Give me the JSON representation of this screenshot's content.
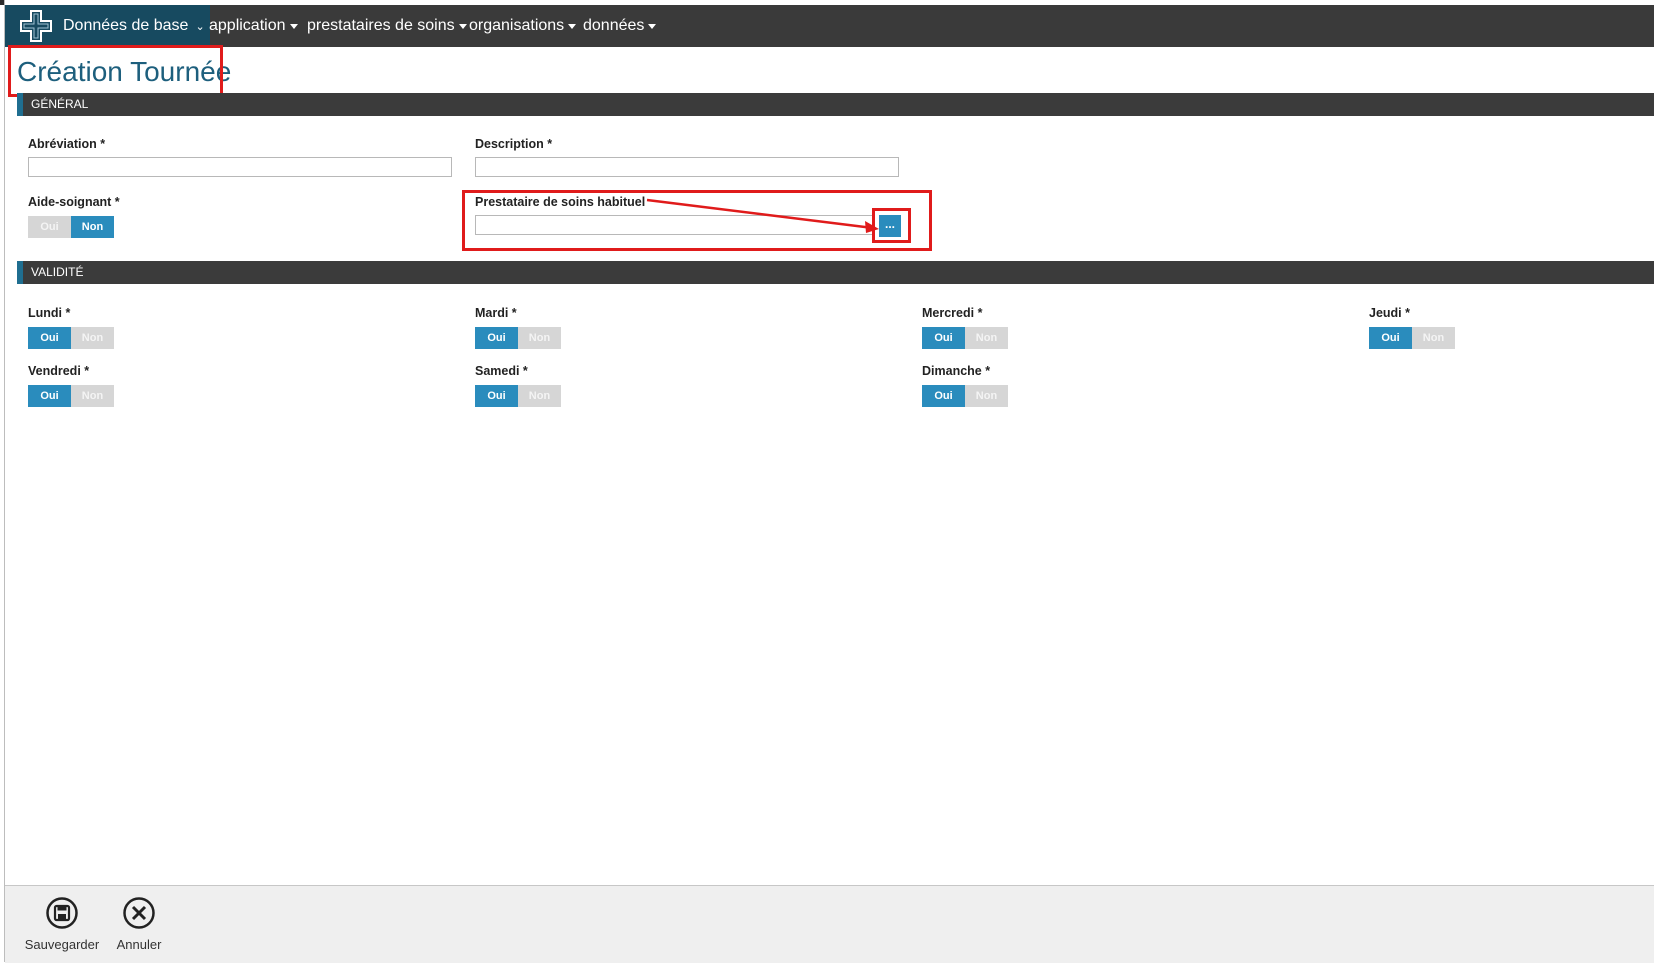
{
  "nav": {
    "brand_label": "Données de base",
    "menus": [
      "application",
      "prestataires de soins",
      "organisations",
      "données"
    ]
  },
  "page": {
    "title": "Création Tournée"
  },
  "sections": {
    "general": "GÉNÉRAL",
    "validity": "VALIDITÉ"
  },
  "general": {
    "abbreviation": {
      "label": "Abréviation *",
      "value": ""
    },
    "description": {
      "label": "Description *",
      "value": ""
    },
    "aide_soignant": {
      "label": "Aide-soignant *",
      "yes": "Oui",
      "no": "Non",
      "selected": "Non"
    },
    "prestataire": {
      "label": "Prestataire de soins habituel",
      "value": "",
      "button": "..."
    }
  },
  "validity": {
    "days": [
      {
        "label": "Lundi *",
        "yes": "Oui",
        "no": "Non",
        "selected": "Oui"
      },
      {
        "label": "Mardi *",
        "yes": "Oui",
        "no": "Non",
        "selected": "Oui"
      },
      {
        "label": "Mercredi *",
        "yes": "Oui",
        "no": "Non",
        "selected": "Oui"
      },
      {
        "label": "Jeudi *",
        "yes": "Oui",
        "no": "Non",
        "selected": "Oui"
      },
      {
        "label": "Vendredi *",
        "yes": "Oui",
        "no": "Non",
        "selected": "Oui"
      },
      {
        "label": "Samedi *",
        "yes": "Oui",
        "no": "Non",
        "selected": "Oui"
      },
      {
        "label": "Dimanche *",
        "yes": "Oui",
        "no": "Non",
        "selected": "Oui"
      }
    ]
  },
  "actions": {
    "save": "Sauvegarder",
    "cancel": "Annuler"
  },
  "colors": {
    "accent": "#2a8cbd",
    "brand": "#174a60",
    "annotation": "#e01b1b"
  },
  "icons": {
    "logo": "medical-cross-icon",
    "save": "floppy-disk-icon",
    "cancel": "close-circle-icon"
  }
}
